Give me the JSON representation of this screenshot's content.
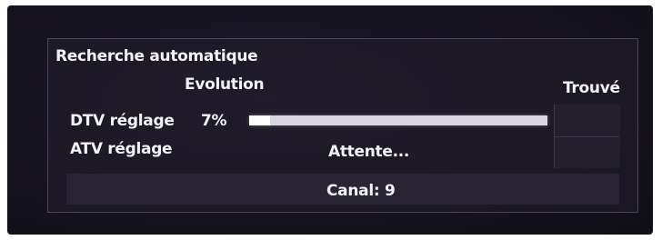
{
  "dialog": {
    "title": "Recherche automatique",
    "columns": {
      "evolution": "Evolution",
      "found": "Trouvé"
    },
    "rows": [
      {
        "label": "DTV réglage",
        "percent_text": "7%",
        "progress_fraction": 0.07
      },
      {
        "label": "ATV réglage",
        "status": "Attente..."
      }
    ],
    "channel": "Canal: 9"
  },
  "colors": {
    "background": "#16131f",
    "text": "#f2f1f6",
    "progress_track": "#d9d6e2",
    "progress_fill": "#ffffff",
    "border": "#4a4658"
  }
}
